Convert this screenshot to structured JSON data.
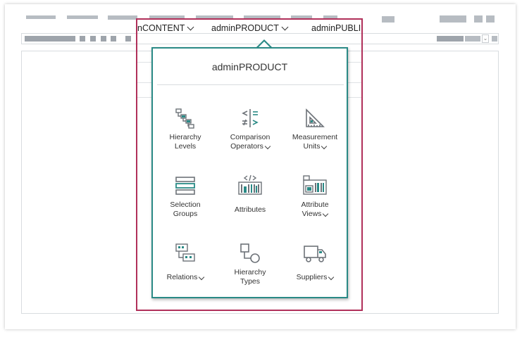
{
  "nav": {
    "tabs": [
      {
        "label": "nCONTENT"
      },
      {
        "label": "adminPRODUCT"
      },
      {
        "label": "adminPUBLI"
      }
    ]
  },
  "toolbar": {
    "dropdown_glyph": "⌄"
  },
  "popup": {
    "title": "adminPRODUCT",
    "items": [
      {
        "label_line1": "Hierarchy",
        "label_line2": "Levels",
        "has_dropdown": false,
        "icon": "hierarchy-levels-icon"
      },
      {
        "label_line1": "Comparison",
        "label_line2": "Operators",
        "has_dropdown": true,
        "icon": "comparison-operators-icon"
      },
      {
        "label_line1": "Measurement",
        "label_line2": "Units",
        "has_dropdown": true,
        "icon": "measurement-units-icon"
      },
      {
        "label_line1": "Selection",
        "label_line2": "Groups",
        "has_dropdown": false,
        "icon": "selection-groups-icon"
      },
      {
        "label_line1": "Attributes",
        "label_line2": "",
        "has_dropdown": false,
        "icon": "attributes-icon"
      },
      {
        "label_line1": "Attribute",
        "label_line2": "Views",
        "has_dropdown": true,
        "icon": "attribute-views-icon"
      },
      {
        "label_line1": "Relations",
        "label_line2": "",
        "has_dropdown": true,
        "icon": "relations-icon"
      },
      {
        "label_line1": "Hierarchy",
        "label_line2": "Types",
        "has_dropdown": false,
        "icon": "hierarchy-types-icon"
      },
      {
        "label_line1": "Suppliers",
        "label_line2": "",
        "has_dropdown": true,
        "icon": "suppliers-icon"
      }
    ]
  },
  "colors": {
    "accent": "#2a8a86",
    "highlight": "#b0305a",
    "icon_gray": "#6d7278",
    "placeholder": "#b7bcc2"
  }
}
